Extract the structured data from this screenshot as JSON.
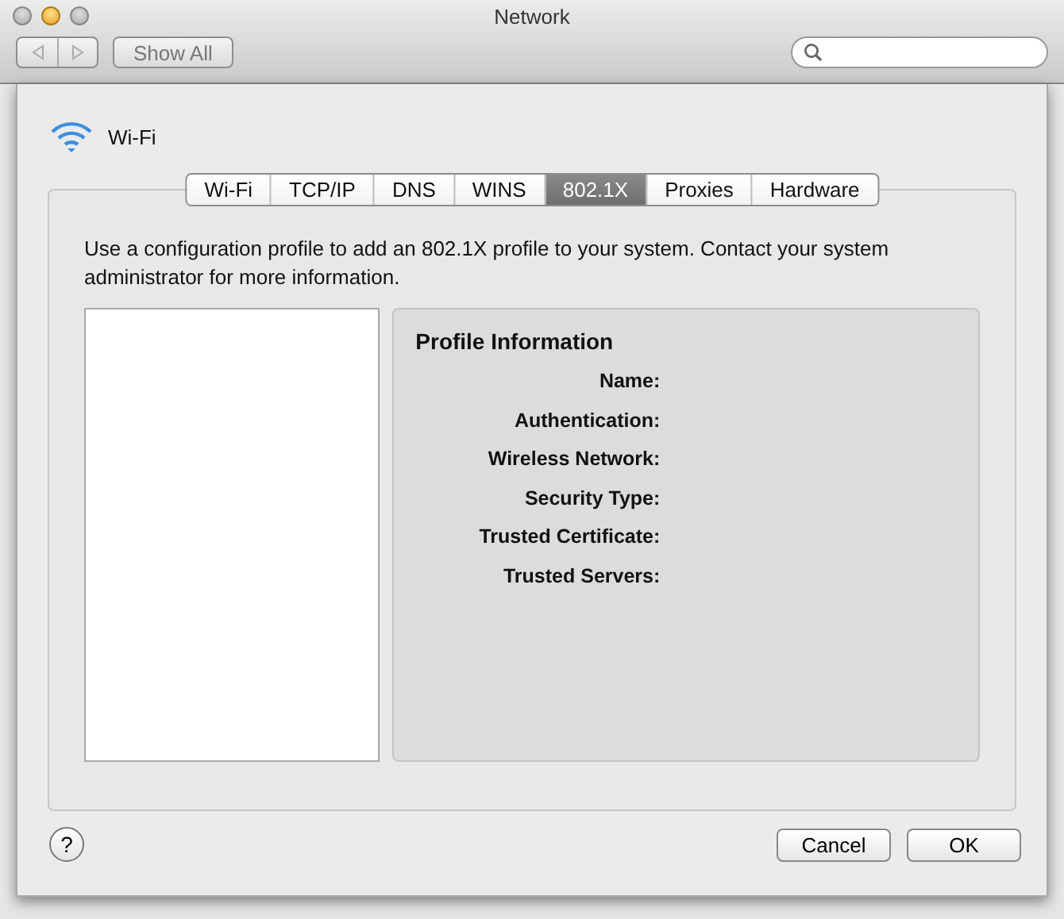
{
  "window": {
    "title": "Network"
  },
  "toolbar": {
    "show_all": "Show All"
  },
  "sheet": {
    "service": "Wi-Fi",
    "tabs": [
      {
        "label": "Wi-Fi",
        "selected": false
      },
      {
        "label": "TCP/IP",
        "selected": false
      },
      {
        "label": "DNS",
        "selected": false
      },
      {
        "label": "WINS",
        "selected": false
      },
      {
        "label": "802.1X",
        "selected": true
      },
      {
        "label": "Proxies",
        "selected": false
      },
      {
        "label": "Hardware",
        "selected": false
      }
    ],
    "description": "Use a configuration profile to add an 802.1X profile to your system. Contact your system administrator for more information.",
    "profile_information": {
      "title": "Profile Information",
      "fields": [
        "Name:",
        "Authentication:",
        "Wireless Network:",
        "Security Type:",
        "Trusted Certificate:",
        "Trusted Servers:"
      ]
    },
    "help": "?",
    "buttons": [
      {
        "label": "Cancel",
        "default": false
      },
      {
        "label": "OK",
        "default": false
      }
    ]
  }
}
